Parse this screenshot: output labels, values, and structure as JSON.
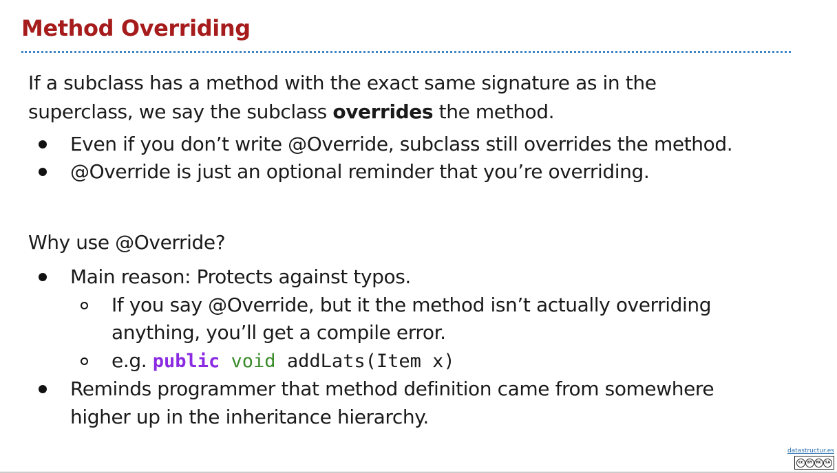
{
  "slide": {
    "title": "Method Overriding",
    "intro": {
      "line1": "If a subclass has a method with the exact same signature as in the",
      "line2_pre": "superclass, we say the subclass ",
      "line2_bold": "overrides",
      "line2_post": " the method."
    },
    "bullets1": [
      "Even if you don’t write @Override, subclass still overrides the method.",
      "@Override is just an optional reminder that you’re overriding."
    ],
    "heading2": "Why use @Override?",
    "bullets2": {
      "main": "Main reason: Protects against typos.",
      "sub1_line1": "If you say @Override, but it the method isn’t actually overriding",
      "sub1_line2": "anything, you’ll get a compile error.",
      "sub2_prefix": "e.g. ",
      "sub2_kw_public": "public",
      "sub2_kw_void": "void",
      "sub2_rest": "addLats(Item x)",
      "reminds_line1": "Reminds programmer that method definition came from somewhere",
      "reminds_line2": "higher up in the inheritance hierarchy."
    }
  },
  "footer": {
    "link": "datastructur.es",
    "license_icon": "creative-commons-by-nc-sa-icon",
    "license_marks": [
      "cc",
      "BY",
      "NC",
      "SA"
    ]
  },
  "colors": {
    "title": "#a61c1c",
    "divider": "#3d85c6",
    "keyword_public": "#8a2be2",
    "keyword_void": "#3a8a2a"
  }
}
